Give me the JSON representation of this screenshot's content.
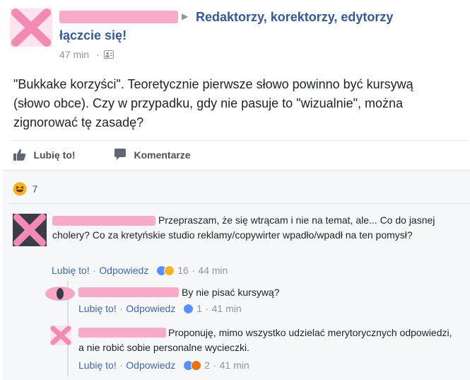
{
  "post": {
    "group_name": "Redaktorzy, korektorzy, edytorzy",
    "group_name_line2": "łączcie się!",
    "time": "47 min",
    "body": "\"Bukkake korzyści\". Teoretycznie pierwsze słowo powinno być kursywą (słowo obce). Czy w przypadku, gdy nie pasuje to \"wizualnie\", można zignorować tę zasadę?"
  },
  "actions": {
    "like_label": "Lubię to!",
    "comment_label": "Komentarze"
  },
  "reactions": {
    "count": "7"
  },
  "comments": [
    {
      "text": "Przepraszam, że się wtrącam i nie na temat, ale... Co do jasnej cholery? Co za kretyńskie studio reklamy/copywirter wpadło/wpadł na ten pomysł?",
      "like": "Lubię to!",
      "reply": "Odpowiedz",
      "reactions": "16",
      "time": "44 min"
    },
    {
      "text": "By nie pisać kursywą?",
      "like": "Lubię to!",
      "reply": "Odpowiedz",
      "reactions": "1",
      "time": "41 min"
    },
    {
      "text": "Proponuję, mimo wszystko udzielać merytorycznych odpowiedzi, a nie robić sobie personalne wycieczki.",
      "like": "Lubię to!",
      "reply": "Odpowiedz",
      "reactions": "2",
      "time": "41 min"
    }
  ],
  "separator": "·",
  "colors": {
    "link": "#365899",
    "comment_link": "#4267b2",
    "meta": "#90949c",
    "redaction": "#f7a6c4",
    "like_blue": "#5890ff",
    "haha_yellow": "#f7b125",
    "angry_orange": "#e9710f"
  }
}
